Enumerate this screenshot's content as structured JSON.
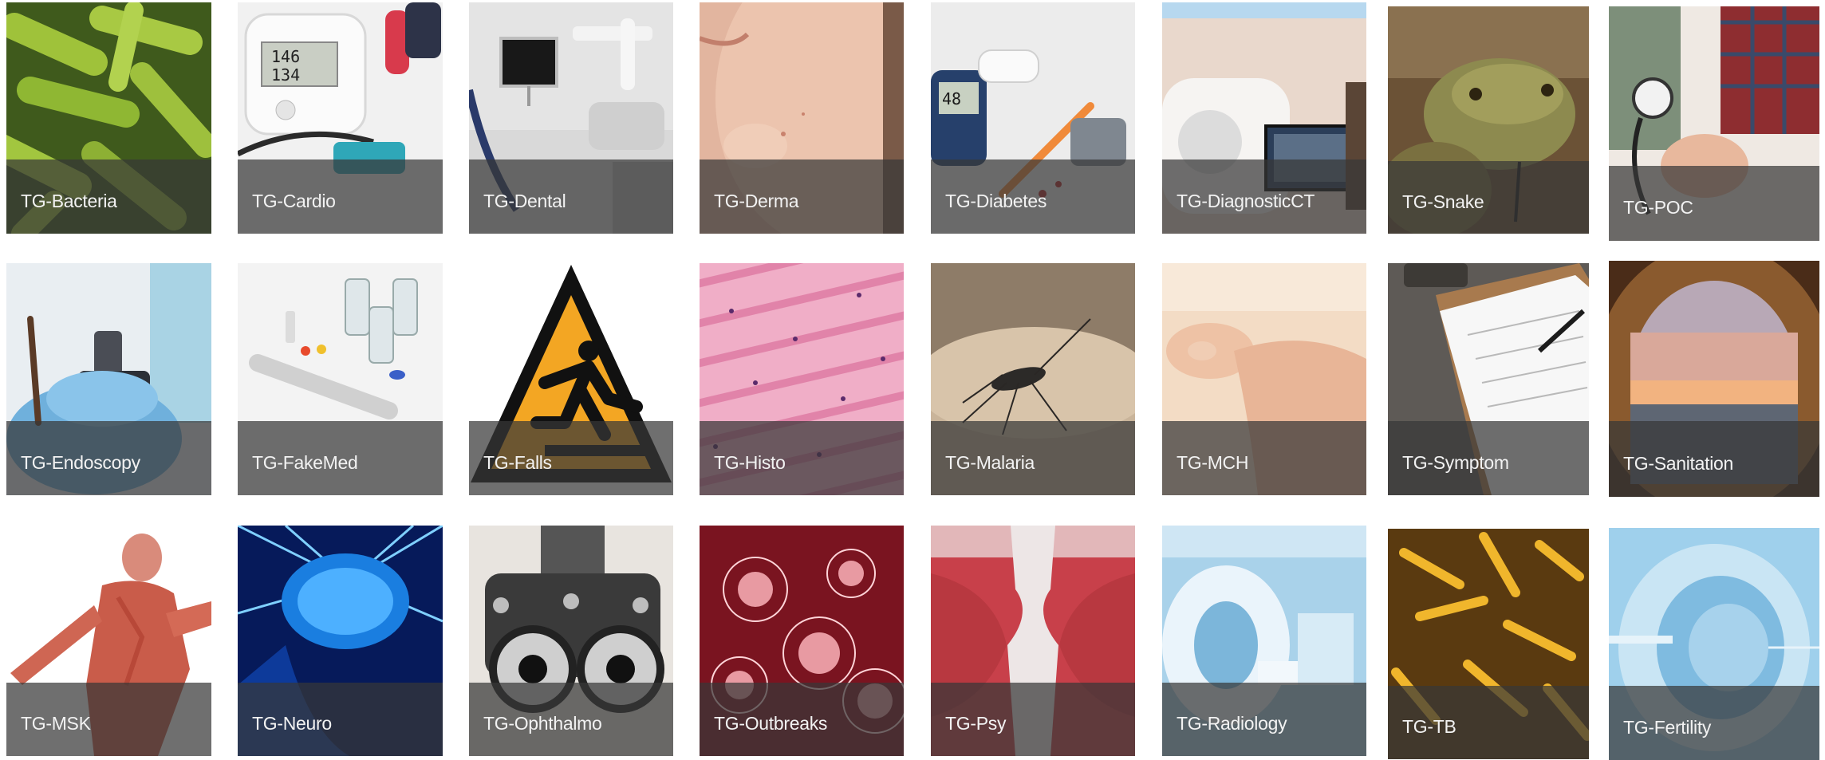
{
  "tiles": [
    {
      "label": "TG-Bacteria"
    },
    {
      "label": "TG-Cardio"
    },
    {
      "label": "TG-Dental"
    },
    {
      "label": "TG-Derma"
    },
    {
      "label": "TG-Diabetes"
    },
    {
      "label": "TG-DiagnosticCT"
    },
    {
      "label": "TG-Snake"
    },
    {
      "label": "TG-POC"
    },
    {
      "label": "TG-Endoscopy"
    },
    {
      "label": "TG-FakeMed"
    },
    {
      "label": "TG-Falls"
    },
    {
      "label": "TG-Histo"
    },
    {
      "label": "TG-Malaria"
    },
    {
      "label": "TG-MCH"
    },
    {
      "label": "TG-Symptom"
    },
    {
      "label": "TG-Sanitation"
    },
    {
      "label": "TG-MSK"
    },
    {
      "label": "TG-Neuro"
    },
    {
      "label": "TG-Ophthalmo"
    },
    {
      "label": "TG-Outbreaks"
    },
    {
      "label": "TG-Psy"
    },
    {
      "label": "TG-Radiology"
    },
    {
      "label": "TG-TB"
    },
    {
      "label": "TG-Fertility"
    }
  ],
  "device_readout": {
    "sys": "146",
    "dia": "134",
    "glucose": "48"
  }
}
